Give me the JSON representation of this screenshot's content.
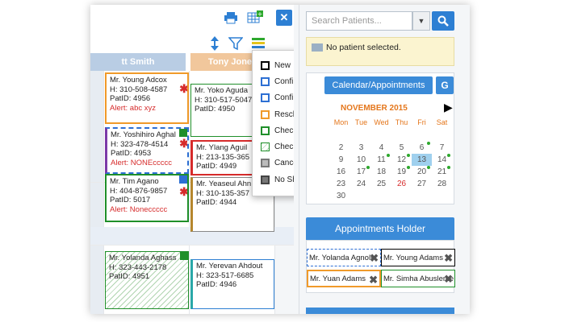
{
  "calendar": {
    "columns": [
      {
        "header": "tt Smith",
        "color": "#b9cde4"
      },
      {
        "header": "Tony Jones",
        "color": "#f1c79c"
      }
    ],
    "appointments": [
      {
        "name": "Mr. Young Adcox",
        "phone": "H: 310-508-4587",
        "pat": "PatID: 4956",
        "alert": "Alert: abc xyz"
      },
      {
        "name": "Mr. Yoshihiro Aghal",
        "phone": "H: 323-478-4514",
        "pat": "PatID: 4953",
        "alert": "Alert: NONEccccc"
      },
      {
        "name": "Mr. Tim Agano",
        "phone": "H: 404-876-9857",
        "pat": "PatID: 5017",
        "alert": "Alert: Noneccccc"
      },
      {
        "name": "Mr. Yolanda Aghass",
        "phone": "H: 323-443-2178",
        "pat": "PatID: 4951"
      },
      {
        "name": "Mr. Yoko Aguda",
        "phone": "H: 310-517-5047",
        "pat": "PatID: 4950"
      },
      {
        "name": "Mr. Ylang Aguil",
        "phone": "H: 213-135-365",
        "pat": "PatID: 4949"
      },
      {
        "name": "Mr. Yeaseul Ahn",
        "phone": "H: 310-135-357",
        "pat": "PatID: 4944"
      },
      {
        "name": "Mr. Yerevan Ahdout",
        "phone": "H: 323-517-6685",
        "pat": "PatID: 4946"
      }
    ]
  },
  "legend": {
    "items": [
      {
        "label": "New",
        "color": "#000000",
        "style": "solid"
      },
      {
        "label": "Confirmed",
        "color": "#2d6fd3",
        "style": "solid"
      },
      {
        "label": "Confirm Hold",
        "color": "#2d6fd3",
        "style": "dashed"
      },
      {
        "label": "Rescheduled",
        "color": "#f09a2a",
        "style": "solid"
      },
      {
        "label": "Check in",
        "color": "#1f8f2a",
        "style": "solid"
      },
      {
        "label": "Check out",
        "color": "#1f8f2a",
        "style": "hatch"
      },
      {
        "label": "Cancel",
        "color": "#888888",
        "style": "filled"
      },
      {
        "label": "No Show",
        "color": "#555555",
        "style": "filled"
      }
    ]
  },
  "search": {
    "placeholder": "Search Patients..."
  },
  "patient_notice": "No patient selected.",
  "cal_widget": {
    "tab_label": "Calendar/Appointments",
    "g_label": "G",
    "month": "NOVEMBER 2015",
    "dow": [
      "Mon",
      "Tue",
      "Wed",
      "Thu",
      "Fri",
      "Sat"
    ],
    "today": "13",
    "red_day": "26",
    "weeks": [
      [
        "",
        "",
        "",
        "",
        "",
        ""
      ],
      [
        "2",
        "3",
        "4",
        "5",
        "6",
        "7"
      ],
      [
        "9",
        "10",
        "11",
        "12",
        "13",
        "14"
      ],
      [
        "16",
        "17",
        "18",
        "19",
        "20",
        "21"
      ],
      [
        "23",
        "24",
        "25",
        "26",
        "27",
        "28"
      ],
      [
        "30",
        "",
        "",
        "",
        "",
        ""
      ]
    ]
  },
  "holder": {
    "title": "Appointments Holder",
    "items": [
      {
        "name": "Mr. Yolanda Agnoli"
      },
      {
        "name": "Mr. Young Adams"
      },
      {
        "name": "Mr. Yuan Adams"
      },
      {
        "name": "Mr. Simha Abusleme"
      }
    ]
  }
}
